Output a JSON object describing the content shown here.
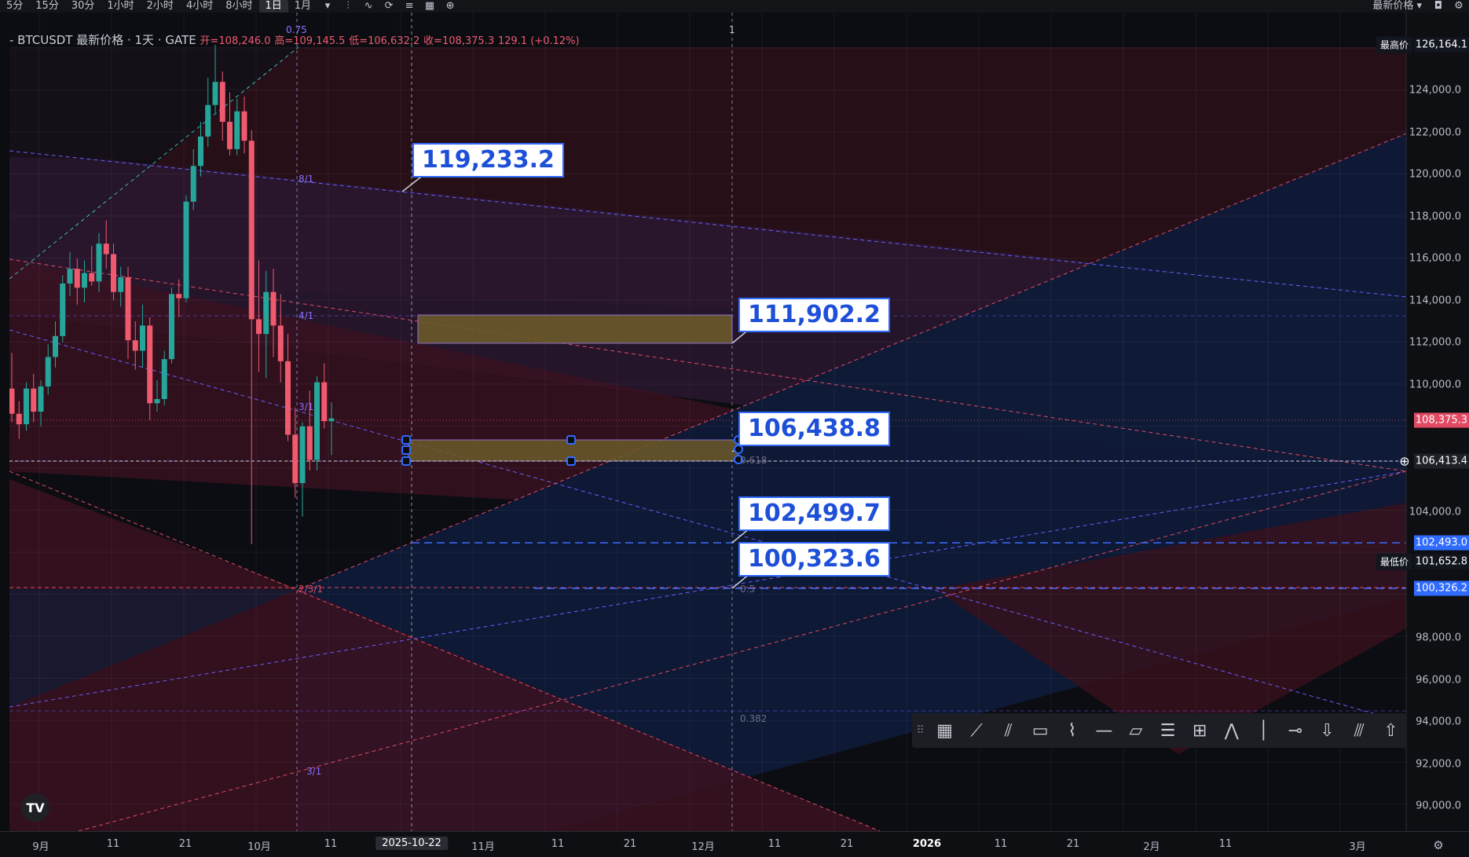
{
  "toolbar": {
    "timeframes": [
      "5分",
      "15分",
      "30分",
      "1小时",
      "2小时",
      "4小时",
      "8小时",
      "1日",
      "1月"
    ],
    "active_timeframe": "1日",
    "price_type": "最新价格"
  },
  "legend": {
    "symbol": "- BTCUSDT 最新价格 · 1天 · GATE",
    "open": "开=108,246.0",
    "high": "高=109,145.5",
    "low": "低=106,632.2",
    "close": "收=108,375.3",
    "change": "129.1 (+0.12%)"
  },
  "y_axis": {
    "labels": [
      "124,000.0",
      "122,000.0",
      "120,000.0",
      "118,000.0",
      "116,000.0",
      "114,000.0",
      "112,000.0",
      "110,000.0",
      "104,000.0",
      "98,000.0",
      "96,000.0",
      "94,000.0",
      "92,000.0",
      "90,000.0"
    ],
    "tags": {
      "high": "126,164.1",
      "high_label": "最高价",
      "last": "108,375.3",
      "cursor": "106,413.4",
      "line1": "102,493.0",
      "low": "101,652.8",
      "low_label": "最低价",
      "line2": "100,326.2"
    }
  },
  "x_axis": {
    "labels": [
      "9月",
      "11",
      "21",
      "10月",
      "11",
      "2025-10-22",
      "11月",
      "11",
      "21",
      "12月",
      "11",
      "21",
      "2026",
      "11",
      "21",
      "2月",
      "11",
      "3月"
    ],
    "highlighted": "2025-10-22"
  },
  "callouts": [
    "119,233.2",
    "111,902.2",
    "106,438.8",
    "102,499.7",
    "100,323.6"
  ],
  "fib_labels": [
    "0.75",
    "1",
    "8/1",
    "4/1",
    "3/1",
    "2/3/1",
    "3/1",
    "0.618",
    "0.5",
    "0.382"
  ],
  "drawing_tools": [
    "grid-icon",
    "trend-line-icon",
    "fan-icon",
    "rectangle-icon",
    "path-icon",
    "horizontal-line-icon",
    "callout-icon",
    "parallel-lines-icon",
    "measure-icon",
    "elliott-wave-icon",
    "vertical-line-icon",
    "horizontal-ray-icon",
    "arrow-down-icon",
    "gann-fan-icon",
    "arrow-up-icon"
  ],
  "chart_data": {
    "type": "candlestick",
    "price_range": [
      88000,
      127500
    ],
    "candles": [
      [
        109800,
        111500,
        108200,
        108600
      ],
      [
        108600,
        109200,
        107400,
        108100
      ],
      [
        108100,
        110100,
        107800,
        109800
      ],
      [
        109800,
        110500,
        108200,
        108700
      ],
      [
        108700,
        110200,
        108000,
        109900
      ],
      [
        109900,
        111900,
        109500,
        111300
      ],
      [
        111300,
        113000,
        110800,
        112300
      ],
      [
        112300,
        115200,
        112000,
        114800
      ],
      [
        114800,
        116300,
        114200,
        115500
      ],
      [
        115500,
        116000,
        113800,
        114600
      ],
      [
        114600,
        115900,
        113900,
        115300
      ],
      [
        115300,
        116600,
        114700,
        114900
      ],
      [
        114900,
        117200,
        114400,
        116700
      ],
      [
        116700,
        117800,
        115500,
        116200
      ],
      [
        116200,
        116700,
        114000,
        114400
      ],
      [
        114400,
        115600,
        113700,
        115100
      ],
      [
        115100,
        115600,
        111200,
        112100
      ],
      [
        112100,
        113000,
        110700,
        111600
      ],
      [
        111600,
        113800,
        110800,
        112800
      ],
      [
        112800,
        113200,
        108300,
        109100
      ],
      [
        109100,
        110200,
        108700,
        109300
      ],
      [
        109300,
        111600,
        109000,
        111200
      ],
      [
        111200,
        114600,
        111000,
        114300
      ],
      [
        114300,
        115000,
        113200,
        114100
      ],
      [
        114100,
        119000,
        113900,
        118700
      ],
      [
        118700,
        121200,
        118300,
        120400
      ],
      [
        120400,
        122500,
        119900,
        121800
      ],
      [
        121800,
        124600,
        121300,
        123300
      ],
      [
        123300,
        126164,
        122900,
        124400
      ],
      [
        124400,
        124900,
        121600,
        122500
      ],
      [
        122500,
        123900,
        120900,
        121200
      ],
      [
        121200,
        123600,
        120900,
        123000
      ],
      [
        123000,
        123700,
        121000,
        121600
      ],
      [
        121600,
        122100,
        102400,
        113100
      ],
      [
        113100,
        115900,
        110600,
        112400
      ],
      [
        112400,
        115400,
        110300,
        114400
      ],
      [
        114400,
        115500,
        111300,
        112800
      ],
      [
        112800,
        114300,
        110100,
        111100
      ],
      [
        111100,
        112400,
        107300,
        107600
      ],
      [
        107600,
        108900,
        104600,
        105300
      ],
      [
        105300,
        108200,
        103700,
        108000
      ],
      [
        108000,
        109700,
        105900,
        106400
      ],
      [
        106400,
        110400,
        105900,
        110100
      ],
      [
        110100,
        111000,
        107900,
        108246
      ],
      [
        108246,
        109145,
        106632,
        108375
      ]
    ]
  }
}
